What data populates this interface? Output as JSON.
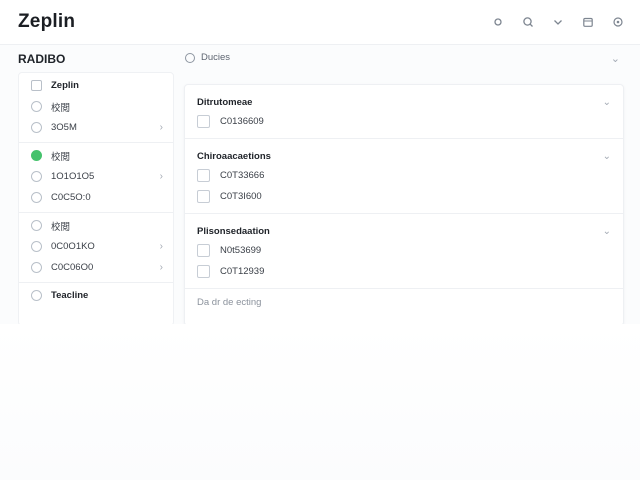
{
  "app": {
    "title": "Zeplin"
  },
  "top_icons": [
    "refresh-icon",
    "search-icon",
    "chevron-down-icon",
    "calendar-icon",
    "settings-icon"
  ],
  "left": {
    "title": "RADIBO",
    "groups": [
      {
        "items": [
          {
            "label": "Zeplin",
            "strong": true,
            "icon": "doc-icon",
            "chevron": false
          },
          {
            "label": "校閲",
            "strong": false,
            "icon": "circle-icon",
            "chevron": false
          },
          {
            "label": "3O5M",
            "strong": false,
            "icon": "circle-icon",
            "chevron": true
          }
        ]
      },
      {
        "items": [
          {
            "label": "校閲",
            "strong": false,
            "icon": "check-icon",
            "chevron": false
          },
          {
            "label": "1O1O1O5",
            "strong": false,
            "icon": "circle-icon",
            "chevron": true
          },
          {
            "label": "C0C5O:0",
            "strong": false,
            "icon": "circle-icon",
            "chevron": false
          }
        ]
      },
      {
        "items": [
          {
            "label": "校閲",
            "strong": false,
            "icon": "circle-icon",
            "chevron": false
          },
          {
            "label": "0C0O1KO",
            "strong": false,
            "icon": "circle-icon",
            "chevron": true
          },
          {
            "label": "C0C06O0",
            "strong": false,
            "icon": "circle-icon",
            "chevron": true
          }
        ]
      },
      {
        "items": [
          {
            "label": "Teacline",
            "strong": true,
            "icon": "circle-icon",
            "chevron": false
          }
        ]
      }
    ]
  },
  "crumb": {
    "label": "Ducies"
  },
  "main": {
    "sections": [
      {
        "title": "Ditrutomeae",
        "rows": [
          "C0136609"
        ]
      },
      {
        "title": "Chiroaacaetions",
        "rows": [
          "C0T33666",
          "C0T3I600"
        ]
      },
      {
        "title": "Plisonsedaation",
        "rows": [
          "N0t53699",
          "C0T12939"
        ]
      }
    ],
    "footer": "Da dr de ecting"
  }
}
